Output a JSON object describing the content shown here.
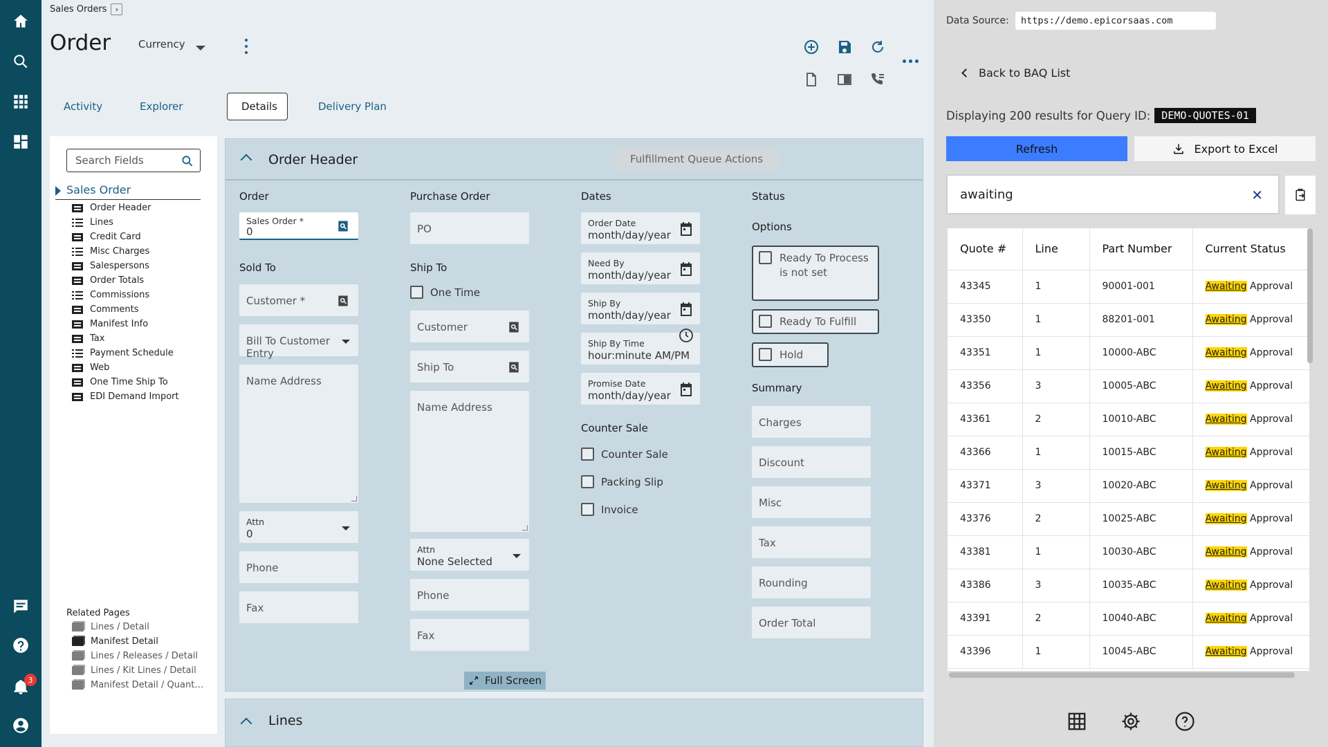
{
  "breadcrumb": {
    "label": "Sales Orders"
  },
  "header": {
    "title": "Order",
    "currency_label": "Currency"
  },
  "tabs": [
    {
      "label": "Activity"
    },
    {
      "label": "Explorer"
    },
    {
      "label": "Details"
    },
    {
      "label": "Delivery Plan"
    }
  ],
  "nav": {
    "notification_count": "3"
  },
  "field_panel": {
    "search_placeholder": "Search Fields",
    "root": "Sales Order",
    "items": [
      "Order Header",
      "Lines",
      "Credit Card",
      "Misc Charges",
      "Salespersons",
      "Order Totals",
      "Commissions",
      "Comments",
      "Manifest Info",
      "Tax",
      "Payment Schedule",
      "Web",
      "One Time Ship To",
      "EDI Demand Import"
    ],
    "related_title": "Related Pages",
    "related": [
      "Lines / Detail",
      "Manifest Detail",
      "Lines / Releases / Detail",
      "Lines / Kit Lines / Detail",
      "Manifest Detail / Quant…"
    ]
  },
  "order_header": {
    "title": "Order Header",
    "fulfillment_button": "Fulfillment Queue Actions",
    "order_section": "Order",
    "sales_order_label": "Sales Order *",
    "sales_order_value": "0",
    "sold_to": "Sold To",
    "customer_placeholder": "Customer *",
    "bill_to_placeholder": "Bill To Customer Entry",
    "name_address_placeholder": "Name Address",
    "attn_label": "Attn",
    "attn_value": "0",
    "phone_placeholder": "Phone",
    "fax_placeholder": "Fax",
    "purchase_order_section": "Purchase Order",
    "po_placeholder": "PO",
    "ship_to_section": "Ship To",
    "one_time_label": "One Time",
    "ship_customer_placeholder": "Customer",
    "ship_to_placeholder": "Ship To",
    "ship_name_address_placeholder": "Name Address",
    "ship_attn_label": "Attn",
    "ship_attn_value": "None Selected",
    "ship_phone_placeholder": "Phone",
    "ship_fax_placeholder": "Fax",
    "dates_section": "Dates",
    "order_date_label": "Order Date",
    "need_by_label": "Need By",
    "ship_by_label": "Ship By",
    "ship_by_time_label": "Ship By Time",
    "promise_date_label": "Promise Date",
    "date_placeholder": "month/day/year",
    "time_placeholder": "hour:minute AM/PM",
    "counter_sale_section": "Counter Sale",
    "counter_sale_label": "Counter Sale",
    "packing_slip_label": "Packing Slip",
    "invoice_label": "Invoice",
    "status_section": "Status",
    "options_label": "Options",
    "ready_to_process": "Ready To Process is not set",
    "ready_to_fulfill": "Ready To Fulfill",
    "hold": "Hold",
    "summary_label": "Summary",
    "charges": "Charges",
    "discount": "Discount",
    "misc": "Misc",
    "tax": "Tax",
    "rounding": "Rounding",
    "order_total": "Order Total",
    "full_screen": "Full Screen"
  },
  "lines_card": {
    "title": "Lines"
  },
  "baq_panel": {
    "data_source_label": "Data Source:",
    "data_source_url": "https://demo.epicorsaas.com",
    "back_label": "Back to BAQ List",
    "displaying_text": "Displaying 200 results for Query ID:",
    "query_id": "DEMO-QUOTES-01",
    "refresh_label": "Refresh",
    "export_label": "Export to Excel",
    "filter_value": "awaiting",
    "columns": [
      "Quote #",
      "Line",
      "Part Number",
      "Current Status"
    ],
    "status_highlight": "Awaiting",
    "status_rest": " Approval",
    "rows": [
      [
        "43345",
        "1",
        "90001-001"
      ],
      [
        "43350",
        "1",
        "88201-001"
      ],
      [
        "43351",
        "1",
        "10000-ABC"
      ],
      [
        "43356",
        "3",
        "10005-ABC"
      ],
      [
        "43361",
        "2",
        "10010-ABC"
      ],
      [
        "43366",
        "1",
        "10015-ABC"
      ],
      [
        "43371",
        "3",
        "10020-ABC"
      ],
      [
        "43376",
        "2",
        "10025-ABC"
      ],
      [
        "43381",
        "1",
        "10030-ABC"
      ],
      [
        "43386",
        "3",
        "10035-ABC"
      ],
      [
        "43391",
        "2",
        "10040-ABC"
      ],
      [
        "43396",
        "1",
        "10045-ABC"
      ]
    ]
  },
  "colors": {
    "rail": "#0c4a5e",
    "accent": "#1a5f86",
    "refresh": "#3c7cff",
    "highlight": "#ffd500"
  }
}
